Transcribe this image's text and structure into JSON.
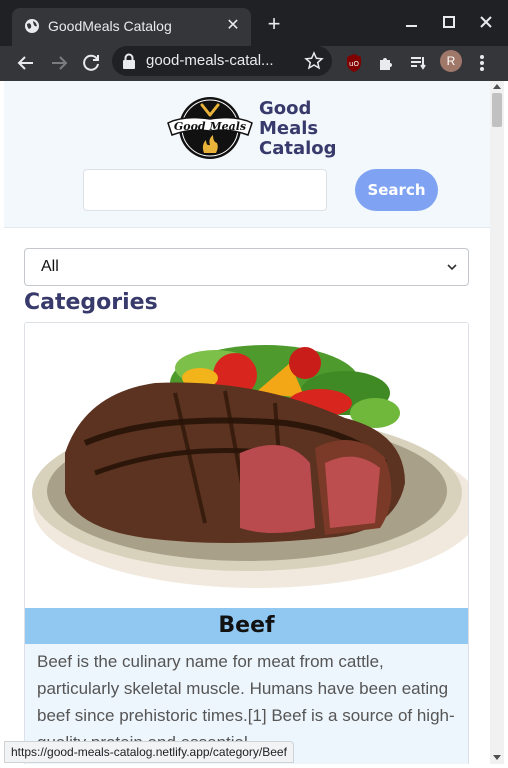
{
  "browser": {
    "tab_title": "GoodMeals Catalog",
    "url": "good-meals-catal...",
    "profile_initial": "R"
  },
  "header": {
    "logo_text": "Good Meals",
    "brand_lines": [
      "Good",
      "Meals",
      "Catalog"
    ],
    "search_placeholder": "",
    "search_button": "Search"
  },
  "filter": {
    "selected": "All"
  },
  "section_title": "Categories",
  "card": {
    "name": "Beef",
    "description": "Beef is the culinary name for meat from cattle, particularly skeletal muscle. Humans have been eating beef since prehistoric times.[1] Beef is a source of high-quality protein and essential"
  },
  "status_link": "https://good-meals-catalog.netlify.app/category/Beef",
  "colors": {
    "brand": "#373a6b",
    "search_button": "#7fa3f2",
    "card_name_bar": "#90c8f2",
    "card_desc_bg": "#eef6fd"
  }
}
